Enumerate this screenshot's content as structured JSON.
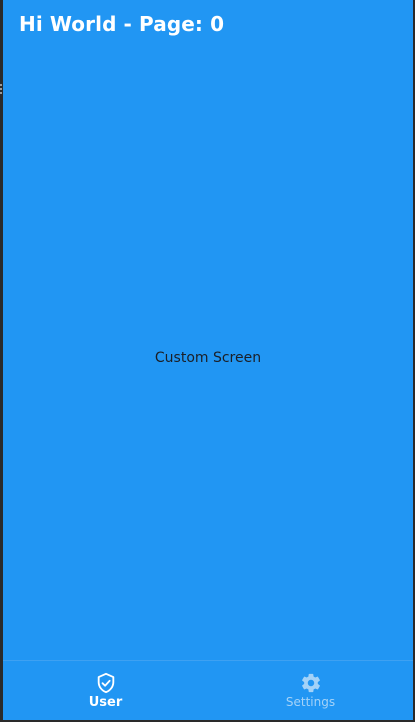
{
  "app_bar": {
    "title": "Hi World - Page: 0"
  },
  "main": {
    "body_text": "Custom Screen"
  },
  "bottom_nav": {
    "items": [
      {
        "label": "User",
        "icon": "shield-check-icon",
        "active": true
      },
      {
        "label": "Settings",
        "icon": "gear-icon",
        "active": false
      }
    ]
  },
  "colors": {
    "primary": "#2196f3",
    "active_nav": "#ffffff",
    "inactive_nav": "#a3d2f8",
    "body_text": "#1b1f26"
  }
}
